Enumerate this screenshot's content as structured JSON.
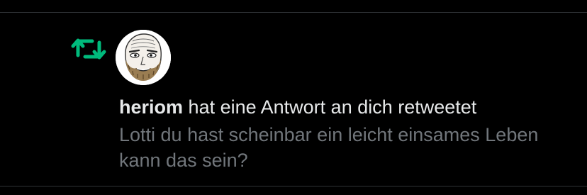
{
  "notification": {
    "type_icon": "retweet-icon",
    "icon_color": "#00ba7c",
    "avatar_icon": "avatar-drawing-icon",
    "username": "heriom",
    "action_text": "hat eine Antwort an dich retweetet",
    "tweet_text": "Lotti du hast scheinbar ein leicht einsames Leben kann das sein?"
  },
  "colors": {
    "background": "#000000",
    "divider": "#2f3336",
    "primary_text": "#e7e9ea",
    "secondary_text": "#71767b"
  }
}
